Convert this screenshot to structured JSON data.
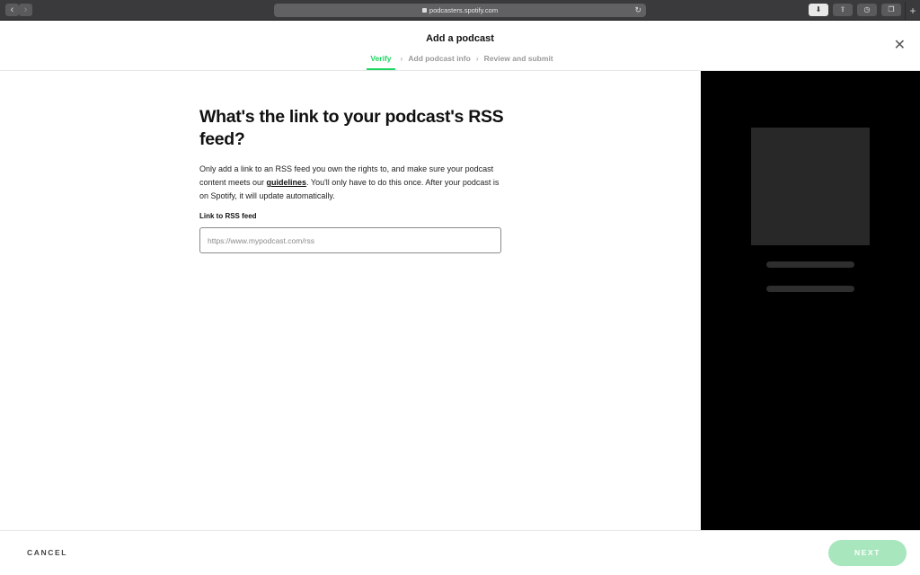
{
  "browser": {
    "back_icon": "‹",
    "forward_icon": "›",
    "url": "podcasters.spotify.com",
    "reload_icon": "↻",
    "toolbar": {
      "download_icon": "⬇",
      "share_icon": "⇪",
      "history_icon": "◷",
      "tabs_icon": "❐",
      "new_tab_icon": "+"
    }
  },
  "header": {
    "title": "Add a podcast",
    "close_icon": "✕",
    "steps": [
      {
        "label": "Verify",
        "active": true
      },
      {
        "label": "Add podcast info",
        "active": false
      },
      {
        "label": "Review and submit",
        "active": false
      }
    ],
    "chevron": "›"
  },
  "form": {
    "heading": "What's the link to your podcast's RSS feed?",
    "desc_before": "Only add a link to an RSS feed you own the rights to, and make sure your podcast content meets our ",
    "desc_link": "guidelines",
    "desc_after": ". You'll only have to do this once. After your podcast is on Spotify, it will update automatically.",
    "field_label": "Link to RSS feed",
    "field_placeholder": "https://www.mypodcast.com/rss",
    "field_value": ""
  },
  "footer": {
    "cancel_label": "CANCEL",
    "next_label": "NEXT"
  },
  "colors": {
    "accent": "#1ed760",
    "next_disabled": "#a8e6bd",
    "preview_bg": "#000000",
    "preview_placeholder": "#282828"
  }
}
